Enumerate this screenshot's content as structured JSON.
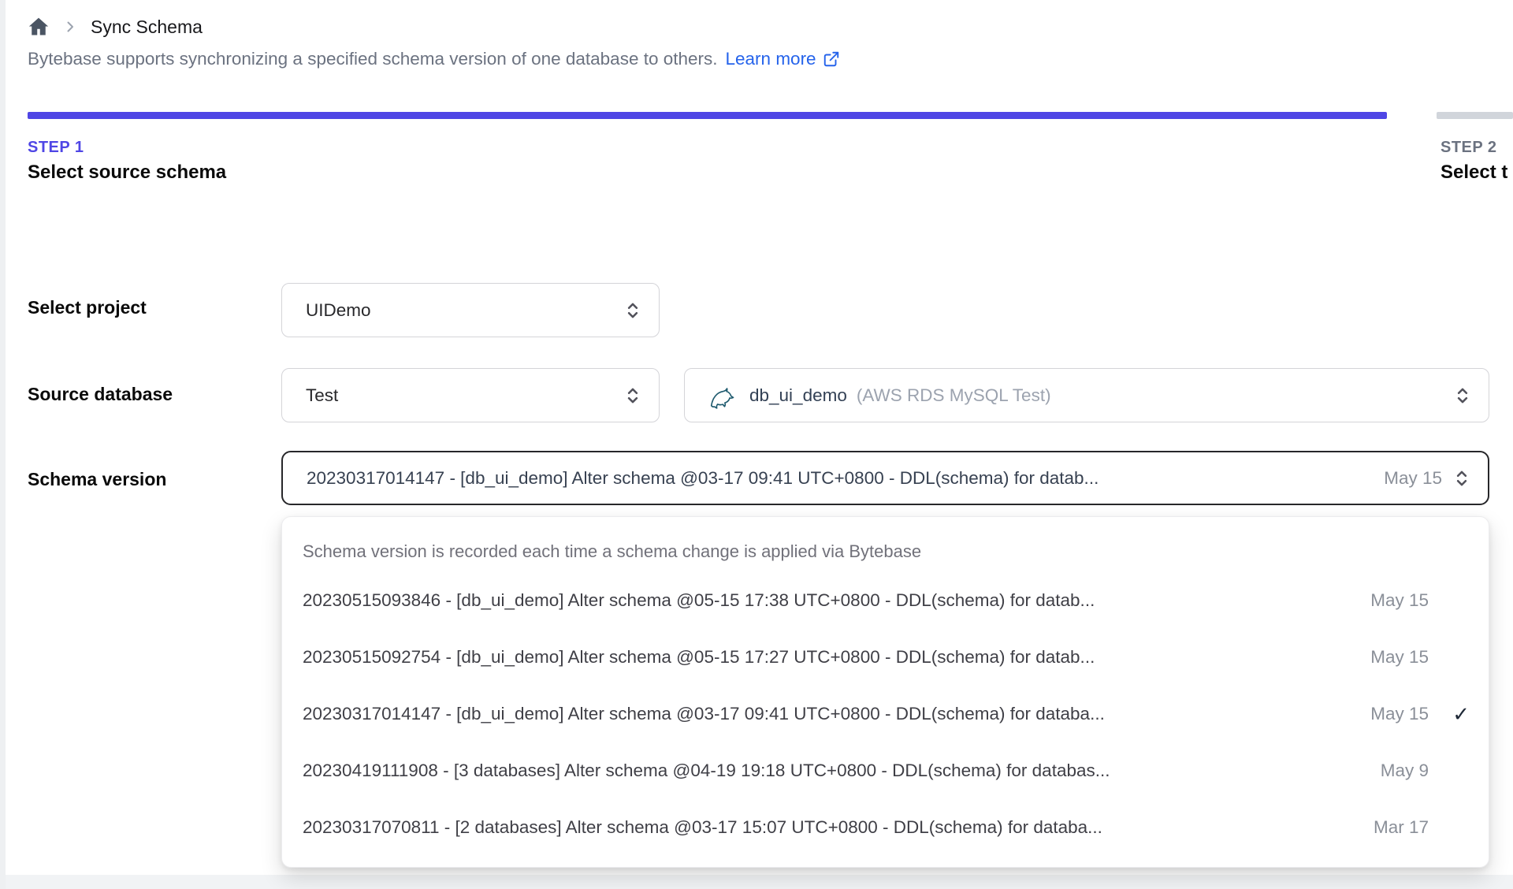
{
  "breadcrumb": {
    "title": "Sync Schema"
  },
  "intro": {
    "text": "Bytebase supports synchronizing a specified schema version of one database to others.",
    "link_label": "Learn more"
  },
  "steps": [
    {
      "label": "STEP 1",
      "title": "Select source schema",
      "state": "active"
    },
    {
      "label": "STEP 2",
      "title": "Select t",
      "state": "upcoming"
    }
  ],
  "form": {
    "project": {
      "label": "Select project",
      "value": "UIDemo"
    },
    "source_database": {
      "label": "Source database",
      "environment_value": "Test",
      "database_name": "db_ui_demo",
      "database_detail": "(AWS RDS MySQL Test)"
    },
    "schema_version": {
      "label": "Schema version",
      "value": "20230317014147 - [db_ui_demo] Alter schema @03-17 09:41 UTC+0800 - DDL(schema) for datab...",
      "date": "May 15"
    }
  },
  "dropdown": {
    "hint": "Schema version is recorded each time a schema change is applied via Bytebase",
    "options": [
      {
        "text": "20230515093846 - [db_ui_demo] Alter schema @05-15 17:38 UTC+0800 - DDL(schema) for datab...",
        "date": "May 15",
        "selected": false
      },
      {
        "text": "20230515092754 - [db_ui_demo] Alter schema @05-15 17:27 UTC+0800 - DDL(schema) for datab...",
        "date": "May 15",
        "selected": false
      },
      {
        "text": "20230317014147 - [db_ui_demo] Alter schema @03-17 09:41 UTC+0800 - DDL(schema) for databa...",
        "date": "May 15",
        "selected": true
      },
      {
        "text": "20230419111908 - [3 databases] Alter schema @04-19 19:18 UTC+0800 - DDL(schema) for databas...",
        "date": "May 9",
        "selected": false
      },
      {
        "text": "20230317070811 - [2 databases] Alter schema @03-17 15:07 UTC+0800 - DDL(schema) for databa...",
        "date": "Mar 17",
        "selected": false
      }
    ]
  },
  "icons": {
    "check": "✓"
  },
  "colors": {
    "accent_indigo": "#4f46e5",
    "link_blue": "#2563eb",
    "inactive_bar_gray": "#d1d5db",
    "muted_text": "#6b7280",
    "focused_border": "#27272a"
  }
}
